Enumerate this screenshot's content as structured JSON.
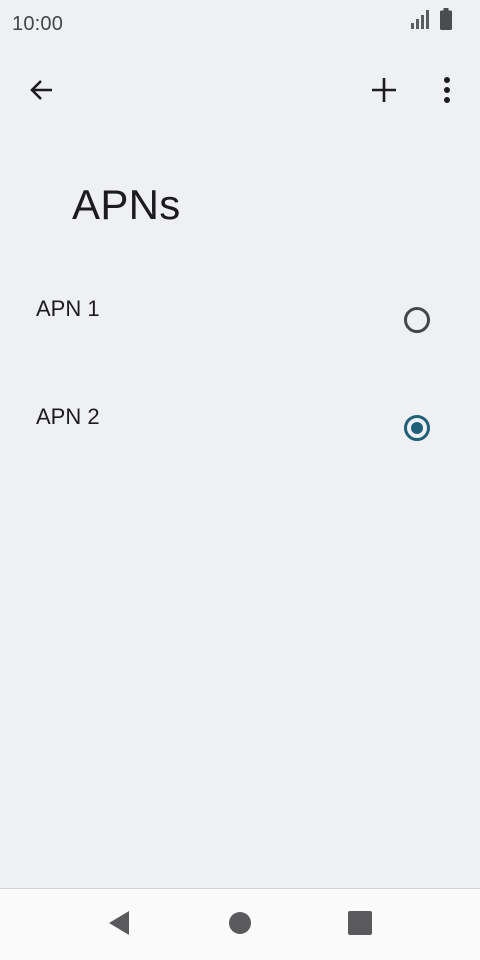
{
  "status_bar": {
    "time": "10:00",
    "icons": [
      "signal-icon",
      "battery-icon"
    ]
  },
  "app_bar": {
    "back_icon": "arrow-left-icon",
    "add_icon": "plus-icon",
    "more_icon": "more-vert-icon"
  },
  "page": {
    "title": "APNs"
  },
  "apns": [
    {
      "label": "APN 1",
      "selected": false
    },
    {
      "label": "APN 2",
      "selected": true
    }
  ],
  "colors": {
    "background": "#eff0f3",
    "accent": "#1f5f78",
    "nav_bar": "#fafafa"
  },
  "nav_bar": {
    "icons": [
      "nav-back-icon",
      "nav-home-icon",
      "nav-recents-icon"
    ]
  }
}
